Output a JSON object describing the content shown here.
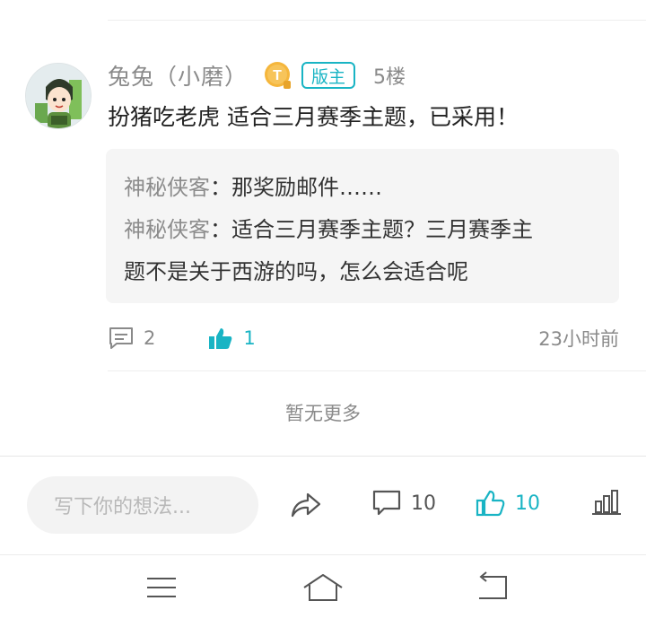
{
  "post": {
    "username": "兔兔（小磨）",
    "level_icon": "level-t-badge-icon",
    "mod_badge": "版主",
    "floor": "5楼",
    "content": "扮猪吃老虎 适合三月赛季主题，已采用！",
    "replies": [
      {
        "name": "神秘侠客",
        "sep": "：",
        "text": "那奖励邮件……"
      },
      {
        "name": "神秘侠客",
        "sep": "：",
        "text": "适合三月赛季主题？三月赛季主",
        "text2": "题不是关于西游的吗，怎么会适合呢"
      }
    ],
    "comment_count": "2",
    "like_count": "1",
    "time": "23小时前"
  },
  "feed": {
    "no_more": "暂无更多"
  },
  "bottom_bar": {
    "input_placeholder": "写下你的想法...",
    "comments": "10",
    "likes": "10"
  },
  "colors": {
    "accent": "#19b4c4",
    "muted": "#8a8a8a",
    "reply_bg": "#f5f5f5"
  }
}
